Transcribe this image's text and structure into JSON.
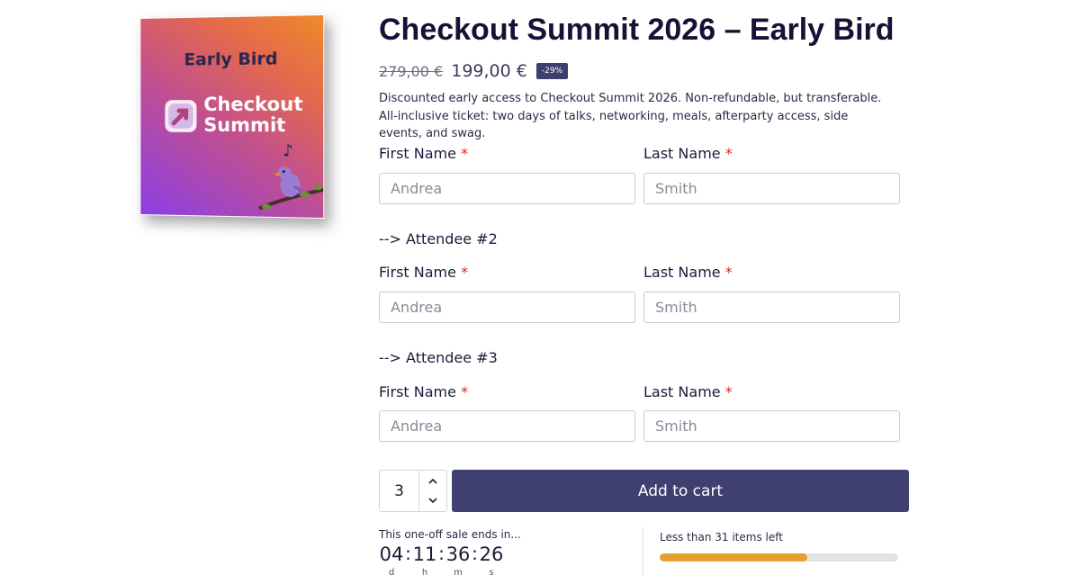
{
  "product": {
    "image": {
      "early_text": "Early Bird",
      "logo_line1": "Checkout",
      "logo_line2": "Summit"
    },
    "title": "Checkout Summit 2026 – Early Bird",
    "old_price": "279,00 €",
    "new_price": "199,00 €",
    "discount_badge": "-29%",
    "description": "Discounted early access to Checkout Summit 2026. Non-refundable, but transferable. All-inclusive ticket: two days of talks, networking, meals, afterparty access, side events, and swag."
  },
  "form": {
    "required_marker": "*",
    "first_name_label": "First Name",
    "last_name_label": "Last Name",
    "first_name_placeholder": "Andrea",
    "last_name_placeholder": "Smith",
    "attendee2_heading": "--> Attendee #2",
    "attendee3_heading": "--> Attendee #3"
  },
  "cart": {
    "quantity": "3",
    "increment_icon": "chevron-up-icon",
    "decrement_icon": "chevron-down-icon",
    "add_to_cart_label": "Add to cart"
  },
  "countdown": {
    "sale_text": "This one-off sale ends in...",
    "days": "04",
    "hours": "11",
    "minutes": "36",
    "seconds": "26",
    "days_label": "d",
    "hours_label": "h",
    "minutes_label": "m",
    "seconds_label": "s",
    "separator": ":"
  },
  "stock": {
    "text": "Less than 31 items left",
    "fill_fraction": 0.62,
    "fill_color": "#e5a02e"
  },
  "colors": {
    "accent": "#3f3f70",
    "required": "#d62828"
  }
}
